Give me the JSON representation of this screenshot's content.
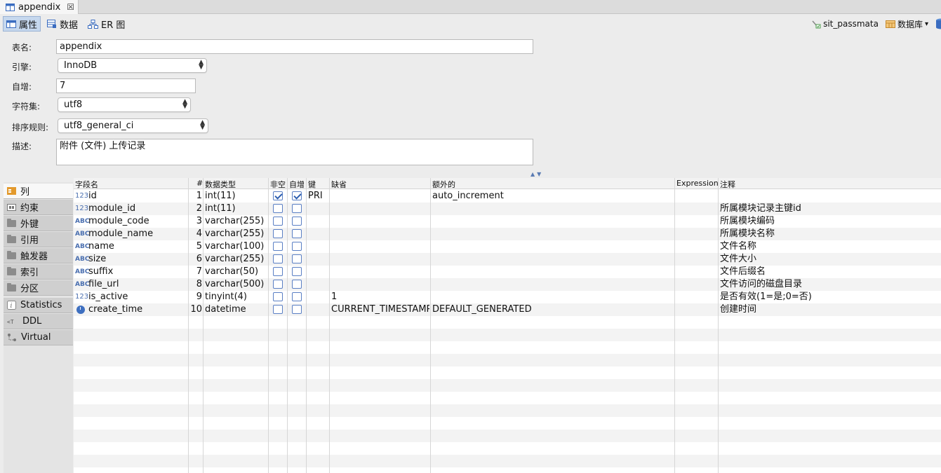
{
  "window": {
    "tab_title": "appendix"
  },
  "toolbar": {
    "tabs": [
      {
        "label": "属性",
        "icon": "table-properties-icon",
        "active": true
      },
      {
        "label": "数据",
        "icon": "table-data-icon",
        "active": false
      },
      {
        "label": "ER 图",
        "icon": "er-diagram-icon",
        "active": false
      }
    ],
    "connection": "sit_passmata",
    "database_label": "数据库",
    "database_arrow": "▾"
  },
  "form": {
    "table_name_label": "表名:",
    "table_name": "appendix",
    "engine_label": "引擎:",
    "engine": "InnoDB",
    "auto_inc_label": "自增:",
    "auto_inc": "7",
    "charset_label": "字符集:",
    "charset": "utf8",
    "collation_label": "排序规则:",
    "collation": "utf8_general_ci",
    "desc_label": "描述:",
    "desc": "附件 (文件) 上传记录"
  },
  "sidenav": [
    "列",
    "约束",
    "外键",
    "引用",
    "触发器",
    "索引",
    "分区",
    "Statistics",
    "DDL",
    "Virtual"
  ],
  "columns_header": [
    "字段名",
    "#",
    "数据类型",
    "非空",
    "自增",
    "键",
    "缺省",
    "额外的",
    "Expression",
    "注释"
  ],
  "rows": [
    {
      "type_icon": "123",
      "name": "id",
      "num": "1",
      "dtype": "int(11)",
      "notnull": true,
      "autoinc": true,
      "key": "PRI",
      "default": "",
      "extra": "auto_increment",
      "expression": "",
      "comment": ""
    },
    {
      "type_icon": "123",
      "name": "module_id",
      "num": "2",
      "dtype": "int(11)",
      "notnull": false,
      "autoinc": false,
      "key": "",
      "default": "",
      "extra": "",
      "expression": "",
      "comment": "所属模块记录主键id"
    },
    {
      "type_icon": "ABC",
      "name": "module_code",
      "num": "3",
      "dtype": "varchar(255)",
      "notnull": false,
      "autoinc": false,
      "key": "",
      "default": "",
      "extra": "",
      "expression": "",
      "comment": "所属模块编码"
    },
    {
      "type_icon": "ABC",
      "name": "module_name",
      "num": "4",
      "dtype": "varchar(255)",
      "notnull": false,
      "autoinc": false,
      "key": "",
      "default": "",
      "extra": "",
      "expression": "",
      "comment": "所属模块名称"
    },
    {
      "type_icon": "ABC",
      "name": "name",
      "num": "5",
      "dtype": "varchar(100)",
      "notnull": false,
      "autoinc": false,
      "key": "",
      "default": "",
      "extra": "",
      "expression": "",
      "comment": "文件名称"
    },
    {
      "type_icon": "ABC",
      "name": "size",
      "num": "6",
      "dtype": "varchar(255)",
      "notnull": false,
      "autoinc": false,
      "key": "",
      "default": "",
      "extra": "",
      "expression": "",
      "comment": "文件大小"
    },
    {
      "type_icon": "ABC",
      "name": "suffix",
      "num": "7",
      "dtype": "varchar(50)",
      "notnull": false,
      "autoinc": false,
      "key": "",
      "default": "",
      "extra": "",
      "expression": "",
      "comment": "文件后缀名"
    },
    {
      "type_icon": "ABC",
      "name": "file_url",
      "num": "8",
      "dtype": "varchar(500)",
      "notnull": false,
      "autoinc": false,
      "key": "",
      "default": "",
      "extra": "",
      "expression": "",
      "comment": "文件访问的磁盘目录"
    },
    {
      "type_icon": "123",
      "name": "is_active",
      "num": "9",
      "dtype": "tinyint(4)",
      "notnull": false,
      "autoinc": false,
      "key": "",
      "default": "1",
      "extra": "",
      "expression": "",
      "comment": "是否有效(1=是;0=否)"
    },
    {
      "type_icon": "clock",
      "name": "create_time",
      "num": "10",
      "dtype": "datetime",
      "notnull": false,
      "autoinc": false,
      "key": "",
      "default": "CURRENT_TIMESTAMP",
      "extra": "DEFAULT_GENERATED",
      "expression": "",
      "comment": "创建时间"
    }
  ]
}
